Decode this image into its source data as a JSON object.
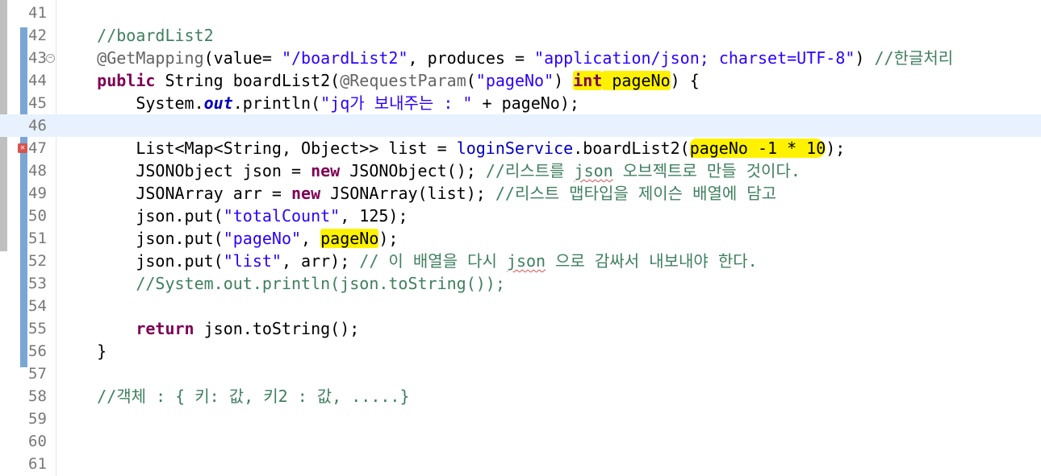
{
  "editor": {
    "lines": [
      {
        "num": "41",
        "tokens": []
      },
      {
        "num": "42",
        "tokens": [
          {
            "t": "    "
          },
          {
            "t": "//boardList2",
            "c": "c-comment"
          }
        ]
      },
      {
        "num": "43",
        "fold": true,
        "tokens": [
          {
            "t": "    "
          },
          {
            "t": "@GetMapping",
            "c": "c-ann"
          },
          {
            "t": "(value= "
          },
          {
            "t": "\"/boardList2\"",
            "c": "c-str"
          },
          {
            "t": ", produces = "
          },
          {
            "t": "\"application/json; charset=UTF-8\"",
            "c": "c-str"
          },
          {
            "t": ") "
          },
          {
            "t": "//한글처리",
            "c": "c-comment"
          }
        ]
      },
      {
        "num": "44",
        "tokens": [
          {
            "t": "    "
          },
          {
            "t": "public",
            "c": "c-kw"
          },
          {
            "t": " String boardList2("
          },
          {
            "t": "@RequestParam",
            "c": "c-ann"
          },
          {
            "t": "("
          },
          {
            "t": "\"pageNo\"",
            "c": "c-str"
          },
          {
            "t": ") "
          },
          {
            "t": "int",
            "c": "c-kw hl"
          },
          {
            "t": " pageNo",
            "c": "hl"
          },
          {
            "t": ") {"
          }
        ]
      },
      {
        "num": "45",
        "tokens": [
          {
            "t": "        System."
          },
          {
            "t": "out",
            "c": "c-static"
          },
          {
            "t": ".println("
          },
          {
            "t": "\"jq가 보내주는 : \"",
            "c": "c-str"
          },
          {
            "t": " + pageNo);"
          }
        ]
      },
      {
        "num": "46",
        "current": true,
        "tokens": []
      },
      {
        "num": "47",
        "error": true,
        "tokens": [
          {
            "t": "        List<Map<String, Object>> list = "
          },
          {
            "t": "loginService",
            "c": "c-field"
          },
          {
            "t": ".boardList2("
          },
          {
            "t": "pageNo -1 * 10",
            "c": "hl-swoosh"
          },
          {
            "t": ");"
          }
        ]
      },
      {
        "num": "48",
        "tokens": [
          {
            "t": "        JSONObject json = "
          },
          {
            "t": "new",
            "c": "c-kw"
          },
          {
            "t": " JSONObject(); "
          },
          {
            "t": "//리스트를 ",
            "c": "c-comment"
          },
          {
            "t": "json",
            "c": "c-comment squiggle"
          },
          {
            "t": " 오브젝트로 만들 것이다.",
            "c": "c-comment"
          }
        ]
      },
      {
        "num": "49",
        "tokens": [
          {
            "t": "        JSONArray arr = "
          },
          {
            "t": "new",
            "c": "c-kw"
          },
          {
            "t": " JSONArray(list); "
          },
          {
            "t": "//리스트 맵타입을 제이슨 배열에 담고",
            "c": "c-comment"
          }
        ]
      },
      {
        "num": "50",
        "tokens": [
          {
            "t": "        json.put("
          },
          {
            "t": "\"totalCount\"",
            "c": "c-str"
          },
          {
            "t": ", 125);"
          }
        ]
      },
      {
        "num": "51",
        "tokens": [
          {
            "t": "        json.put("
          },
          {
            "t": "\"pageNo\"",
            "c": "c-str"
          },
          {
            "t": ", "
          },
          {
            "t": "pageNo",
            "c": "hl"
          },
          {
            "t": ");"
          }
        ]
      },
      {
        "num": "52",
        "tokens": [
          {
            "t": "        json.put("
          },
          {
            "t": "\"list\"",
            "c": "c-str"
          },
          {
            "t": ", arr); "
          },
          {
            "t": "// 이 배열을 다시 ",
            "c": "c-comment"
          },
          {
            "t": "json",
            "c": "c-comment squiggle"
          },
          {
            "t": " 으로 감싸서 내보내야 한다.",
            "c": "c-comment"
          }
        ]
      },
      {
        "num": "53",
        "tokens": [
          {
            "t": "        "
          },
          {
            "t": "//System.out.println(json.toString());",
            "c": "c-comment"
          }
        ]
      },
      {
        "num": "54",
        "tokens": []
      },
      {
        "num": "55",
        "tokens": [
          {
            "t": "        "
          },
          {
            "t": "return",
            "c": "c-kw"
          },
          {
            "t": " json.toString();"
          }
        ]
      },
      {
        "num": "56",
        "tokens": [
          {
            "t": "    }"
          }
        ]
      },
      {
        "num": "57",
        "tokens": []
      },
      {
        "num": "58",
        "tokens": [
          {
            "t": "    "
          },
          {
            "t": "//객체 : { 키: 값, 키2 : 값, .....}",
            "c": "c-comment"
          }
        ]
      },
      {
        "num": "59",
        "tokens": []
      },
      {
        "num": "60",
        "tokens": []
      },
      {
        "num": "61",
        "tokens": []
      }
    ]
  }
}
